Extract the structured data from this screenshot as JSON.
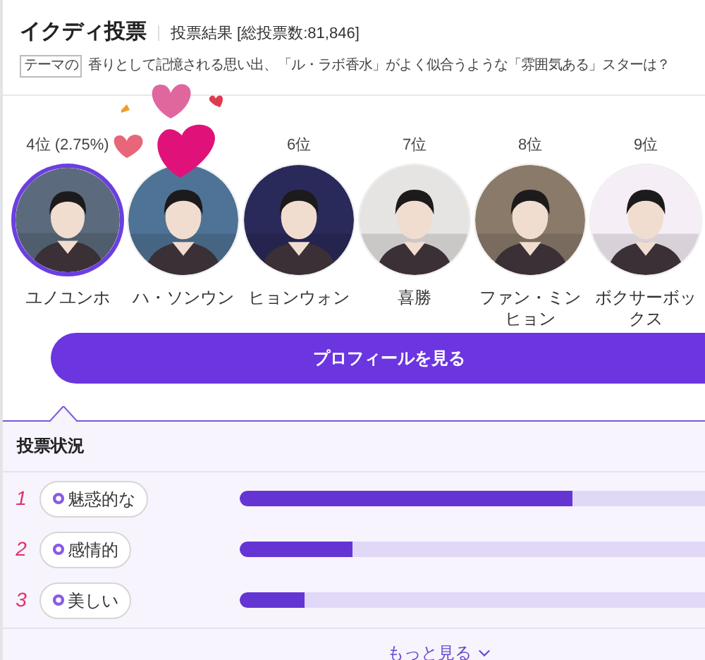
{
  "header": {
    "title": "イクディ投票",
    "subtitle": "投票結果 [総投票数:81,846]"
  },
  "theme": {
    "tag": "テーマの",
    "question": "香りとして記憶される思い出、「ル・ラボ香水」がよく似合うような「雰囲気ある」スターは？"
  },
  "candidates": [
    {
      "rank": "4位 (2.75%)",
      "name": "ユノユンホ",
      "selected": true,
      "color": "#5b6a7c"
    },
    {
      "name": "ハ・ソンウン",
      "selected": false,
      "color": "#4f7396"
    },
    {
      "rank": "6位",
      "name": "ヒョンウォン",
      "selected": false,
      "color": "#2a2a5a"
    },
    {
      "rank": "7位",
      "name": "喜勝",
      "selected": false,
      "color": "#e6e4e2"
    },
    {
      "rank": "8位",
      "name": "ファン・ミンヒョン",
      "selected": false,
      "color": "#8a7a6a"
    },
    {
      "rank": "9位",
      "name": "ボクサーボックス",
      "selected": false,
      "color": "#f6eef6"
    }
  ],
  "profile_button": "プロフィールを見る",
  "status": {
    "title": "投票状況",
    "rows": [
      {
        "number": "1",
        "label": "魅惑的な",
        "level": 0.71
      },
      {
        "number": "2",
        "label": "感情的",
        "level": 0.24
      },
      {
        "number": "3",
        "label": "美しい",
        "level": 0.14
      }
    ],
    "more": "もっと見る"
  }
}
